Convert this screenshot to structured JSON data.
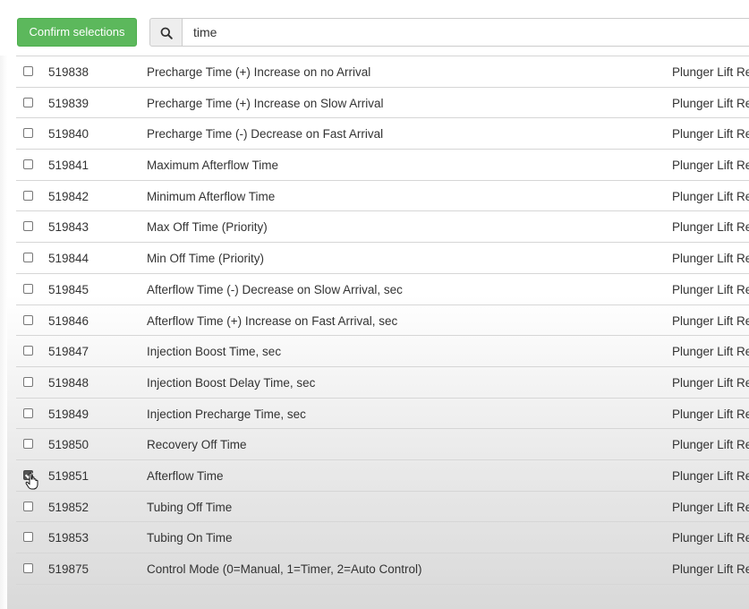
{
  "toolbar": {
    "confirm_label": "Confirm selections",
    "search_icon": "search-icon",
    "search_value": "time"
  },
  "rows": [
    {
      "checked": false,
      "id": "519838",
      "name": "Precharge Time (+) Increase on no Arrival",
      "category": "Plunger Lift Re"
    },
    {
      "checked": false,
      "id": "519839",
      "name": "Precharge Time (+) Increase on Slow Arrival",
      "category": "Plunger Lift Re"
    },
    {
      "checked": false,
      "id": "519840",
      "name": "Precharge Time (-) Decrease on Fast Arrival",
      "category": "Plunger Lift Re"
    },
    {
      "checked": false,
      "id": "519841",
      "name": "Maximum Afterflow Time",
      "category": "Plunger Lift Re"
    },
    {
      "checked": false,
      "id": "519842",
      "name": "Minimum Afterflow Time",
      "category": "Plunger Lift Re"
    },
    {
      "checked": false,
      "id": "519843",
      "name": "Max Off Time (Priority)",
      "category": "Plunger Lift Re"
    },
    {
      "checked": false,
      "id": "519844",
      "name": "Min Off Time (Priority)",
      "category": "Plunger Lift Re"
    },
    {
      "checked": false,
      "id": "519845",
      "name": "Afterflow Time (-) Decrease on Slow Arrival, sec",
      "category": "Plunger Lift Re"
    },
    {
      "checked": false,
      "id": "519846",
      "name": "Afterflow Time (+) Increase on Fast Arrival, sec",
      "category": "Plunger Lift Re"
    },
    {
      "checked": false,
      "id": "519847",
      "name": "Injection Boost Time, sec",
      "category": "Plunger Lift Re"
    },
    {
      "checked": false,
      "id": "519848",
      "name": "Injection Boost Delay Time, sec",
      "category": "Plunger Lift Re"
    },
    {
      "checked": false,
      "id": "519849",
      "name": "Injection Precharge Time, sec",
      "category": "Plunger Lift Re"
    },
    {
      "checked": false,
      "id": "519850",
      "name": "Recovery Off Time",
      "category": "Plunger Lift Re"
    },
    {
      "checked": true,
      "id": "519851",
      "name": "Afterflow Time",
      "category": "Plunger Lift Re"
    },
    {
      "checked": false,
      "id": "519852",
      "name": "Tubing Off Time",
      "category": "Plunger Lift Re"
    },
    {
      "checked": false,
      "id": "519853",
      "name": "Tubing On Time",
      "category": "Plunger Lift Re"
    },
    {
      "checked": false,
      "id": "519875",
      "name": "Control Mode (0=Manual, 1=Timer, 2=Auto Control)",
      "category": "Plunger Lift Re"
    }
  ]
}
